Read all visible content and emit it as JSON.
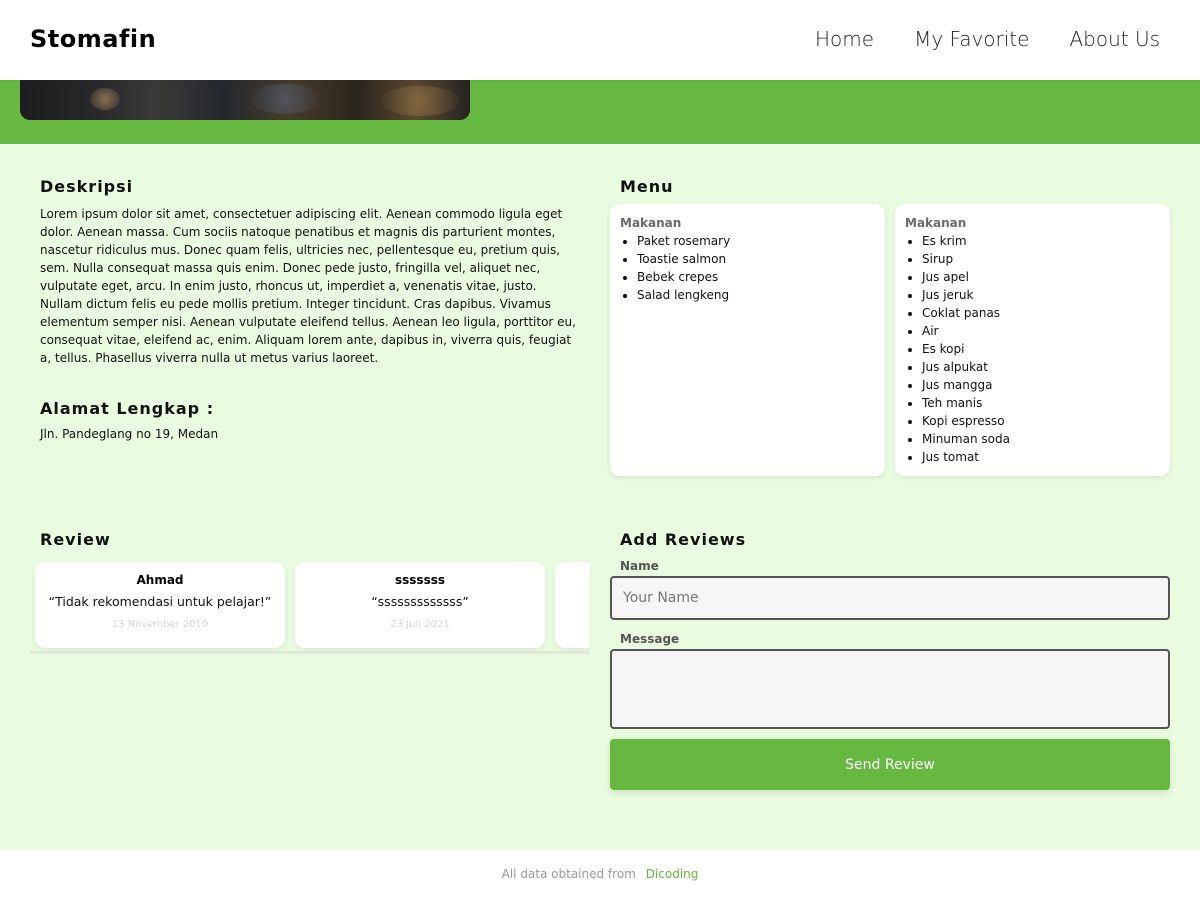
{
  "brand": "Stomafin",
  "nav": {
    "home": "Home",
    "favorite": "My Favorite",
    "about": "About Us"
  },
  "colors": {
    "accent": "#66b840",
    "page_bg": "#eafce0"
  },
  "description": {
    "title": "Deskripsi",
    "text": "Lorem ipsum dolor sit amet, consectetuer adipiscing elit. Aenean commodo ligula eget dolor. Aenean massa. Cum sociis natoque penatibus et magnis dis parturient montes, nascetur ridiculus mus. Donec quam felis, ultricies nec, pellentesque eu, pretium quis, sem. Nulla consequat massa quis enim. Donec pede justo, fringilla vel, aliquet nec, vulputate eget, arcu. In enim justo, rhoncus ut, imperdiet a, venenatis vitae, justo. Nullam dictum felis eu pede mollis pretium. Integer tincidunt. Cras dapibus. Vivamus elementum semper nisi. Aenean vulputate eleifend tellus. Aenean leo ligula, porttitor eu, consequat vitae, eleifend ac, enim. Aliquam lorem ante, dapibus in, viverra quis, feugiat a, tellus. Phasellus viverra nulla ut metus varius laoreet."
  },
  "address": {
    "title": "Alamat Lengkap :",
    "text": "Jln. Pandeglang no 19, Medan"
  },
  "menu": {
    "title": "Menu",
    "foods": {
      "category": "Makanan",
      "items": [
        "Paket rosemary",
        "Toastie salmon",
        "Bebek crepes",
        "Salad lengkeng"
      ]
    },
    "drinks": {
      "category": "Makanan",
      "items": [
        "Es krim",
        "Sirup",
        "Jus apel",
        "Jus jeruk",
        "Coklat panas",
        "Air",
        "Es kopi",
        "Jus alpukat",
        "Jus mangga",
        "Teh manis",
        "Kopi espresso",
        "Minuman soda",
        "Jus tomat"
      ]
    }
  },
  "reviews": {
    "title": "Review",
    "items": [
      {
        "name": "Ahmad",
        "text": "“Tidak rekomendasi untuk pelajar!”",
        "date": "13 November 2019"
      },
      {
        "name": "sssssss",
        "text": "“sssssssssssss”",
        "date": "23 Juli 2021"
      },
      {
        "name": "",
        "text": "",
        "date": ""
      }
    ]
  },
  "add_review": {
    "title": "Add Reviews",
    "name_label": "Name",
    "name_placeholder": "Your Name",
    "message_label": "Message",
    "send_label": "Send Review"
  },
  "footer": {
    "text": "All data obtained from",
    "link": "Dicoding"
  }
}
